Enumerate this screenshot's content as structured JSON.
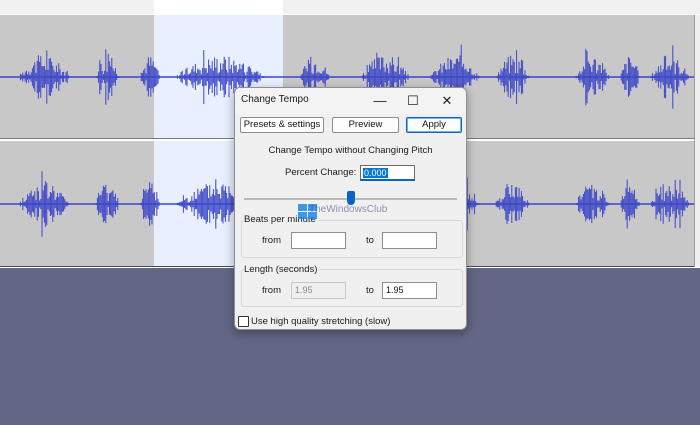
{
  "window": {
    "title": "Change Tempo",
    "minimize_icon": "—",
    "maximize_icon": "☐",
    "close_icon": "✕"
  },
  "toolbar": {
    "presets_label": "Presets & settings",
    "preview_label": "Preview",
    "apply_label": "Apply"
  },
  "heading": "Change Tempo without Changing Pitch",
  "percent_change": {
    "label": "Percent Change:",
    "value": "0.000",
    "slider_fraction": 0.5
  },
  "beats_per_minute": {
    "title": "Beats per minute",
    "from_label": "from",
    "from_value": "",
    "to_label": "to",
    "to_value": ""
  },
  "length": {
    "title": "Length (seconds)",
    "from_label": "from",
    "from_value": "1.95",
    "to_label": "to",
    "to_value": "1.95"
  },
  "high_quality": {
    "label": "Use high quality stretching (slow)",
    "checked": false
  },
  "watermark": "TheWindowsClub",
  "colors": {
    "accent": "#0a64c8",
    "waveform": "#3c46c8",
    "selection": "#e8efff",
    "background": "#626786"
  }
}
